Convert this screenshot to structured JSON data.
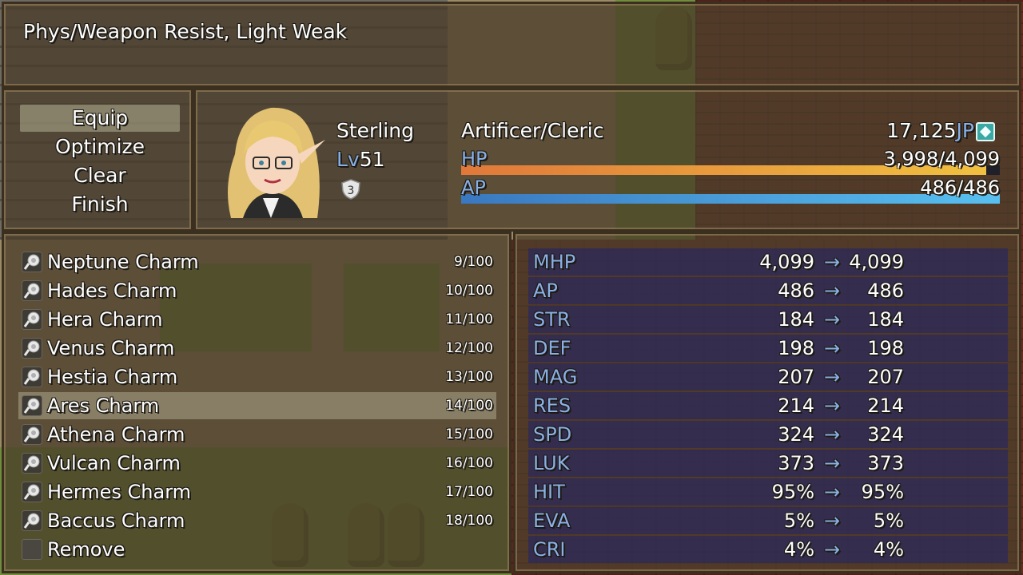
{
  "help": {
    "text": "Phys/Weapon Resist, Light Weak"
  },
  "commands": [
    {
      "label": "Equip",
      "selected": true
    },
    {
      "label": "Optimize",
      "selected": false
    },
    {
      "label": "Clear",
      "selected": false
    },
    {
      "label": "Finish",
      "selected": false
    }
  ],
  "actor": {
    "name": "Sterling",
    "level_label": "Lv",
    "level": "51",
    "badge": "3",
    "class": "Artificer/Cleric",
    "jp_value": "17,125",
    "jp_unit": "JP",
    "hp": {
      "label": "HP",
      "text": "3,998/4,099",
      "current": 3998,
      "max": 4099
    },
    "ap": {
      "label": "AP",
      "text": "486/486",
      "current": 486,
      "max": 486
    }
  },
  "items": [
    {
      "name": "Neptune Charm",
      "count": "9/100"
    },
    {
      "name": "Hades Charm",
      "count": "10/100"
    },
    {
      "name": "Hera Charm",
      "count": "11/100"
    },
    {
      "name": "Venus Charm",
      "count": "12/100"
    },
    {
      "name": "Hestia Charm",
      "count": "13/100"
    },
    {
      "name": "Ares Charm",
      "count": "14/100",
      "selected": true
    },
    {
      "name": "Athena Charm",
      "count": "15/100"
    },
    {
      "name": "Vulcan Charm",
      "count": "16/100"
    },
    {
      "name": "Hermes Charm",
      "count": "17/100"
    },
    {
      "name": "Baccus Charm",
      "count": "18/100"
    },
    {
      "name": "Remove",
      "count": ""
    }
  ],
  "stats": [
    {
      "key": "MHP",
      "before": "4,099",
      "after": "4,099"
    },
    {
      "key": "AP",
      "before": "486",
      "after": "486"
    },
    {
      "key": "STR",
      "before": "184",
      "after": "184"
    },
    {
      "key": "DEF",
      "before": "198",
      "after": "198"
    },
    {
      "key": "MAG",
      "before": "207",
      "after": "207"
    },
    {
      "key": "RES",
      "before": "214",
      "after": "214"
    },
    {
      "key": "SPD",
      "before": "324",
      "after": "324"
    },
    {
      "key": "LUK",
      "before": "373",
      "after": "373"
    },
    {
      "key": "HIT",
      "before": "95%",
      "after": "95%"
    },
    {
      "key": "EVA",
      "before": "5%",
      "after": "5%"
    },
    {
      "key": "CRI",
      "before": "4%",
      "after": "4%"
    }
  ],
  "arrow_glyph": "→",
  "colors": {
    "label_blue": "#8ab0e6",
    "hp_bar": "#e0783a",
    "ap_bar": "#3a78c0",
    "stat_row": "#2a285c"
  }
}
